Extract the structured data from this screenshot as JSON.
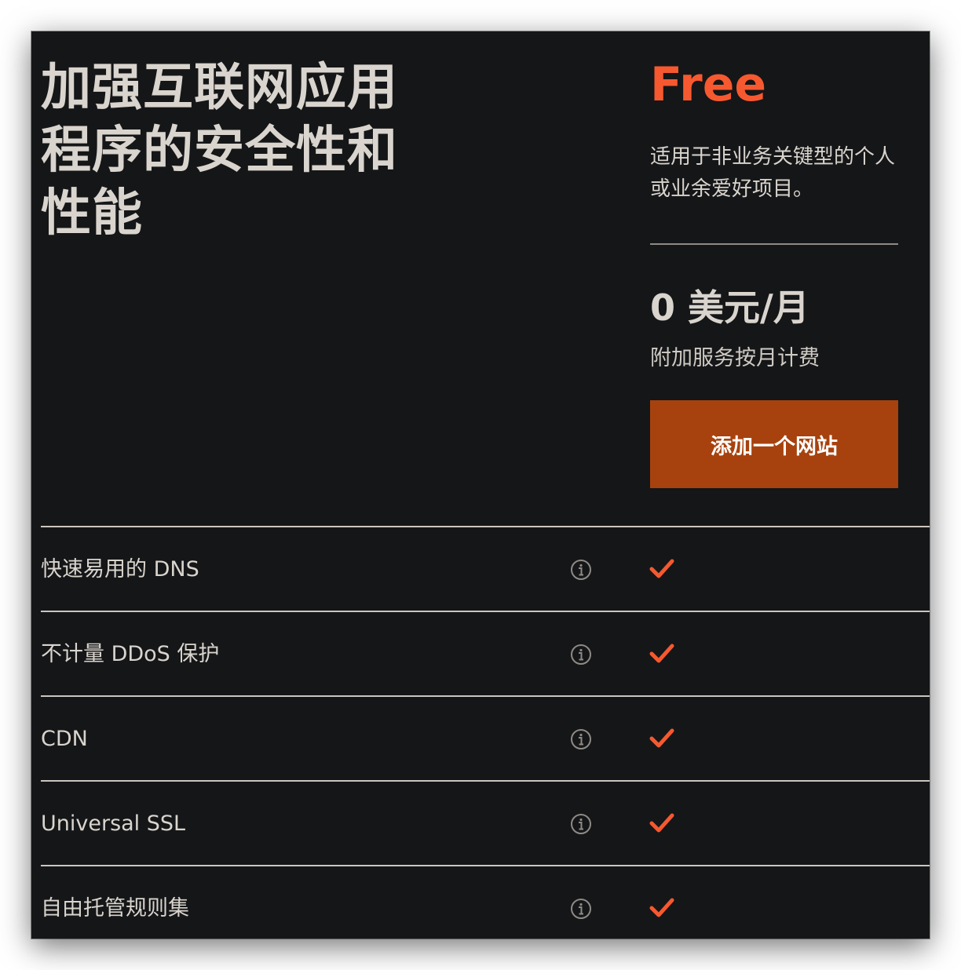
{
  "headline": "加强互联网应用程序的安全性和性能",
  "plan": {
    "name": "Free",
    "description": "适用于非业务关键型的个人或业余爱好项目。",
    "price": "0 美元/月",
    "price_note": "附加服务按月计费",
    "cta_label": "添加一个网站"
  },
  "features": [
    {
      "label": "快速易用的 DNS",
      "included": true
    },
    {
      "label": "不计量 DDoS 保护",
      "included": true
    },
    {
      "label": "CDN",
      "included": true
    },
    {
      "label": "Universal SSL",
      "included": true
    },
    {
      "label": "自由托管规则集",
      "included": true
    }
  ],
  "icons": {
    "info": "info-circle-icon",
    "check": "checkmark-icon"
  },
  "colors": {
    "background": "#151618",
    "text": "#d9d4cd",
    "accent": "#f6592f",
    "button": "#a7420e",
    "divider": "#cbc6bf"
  }
}
